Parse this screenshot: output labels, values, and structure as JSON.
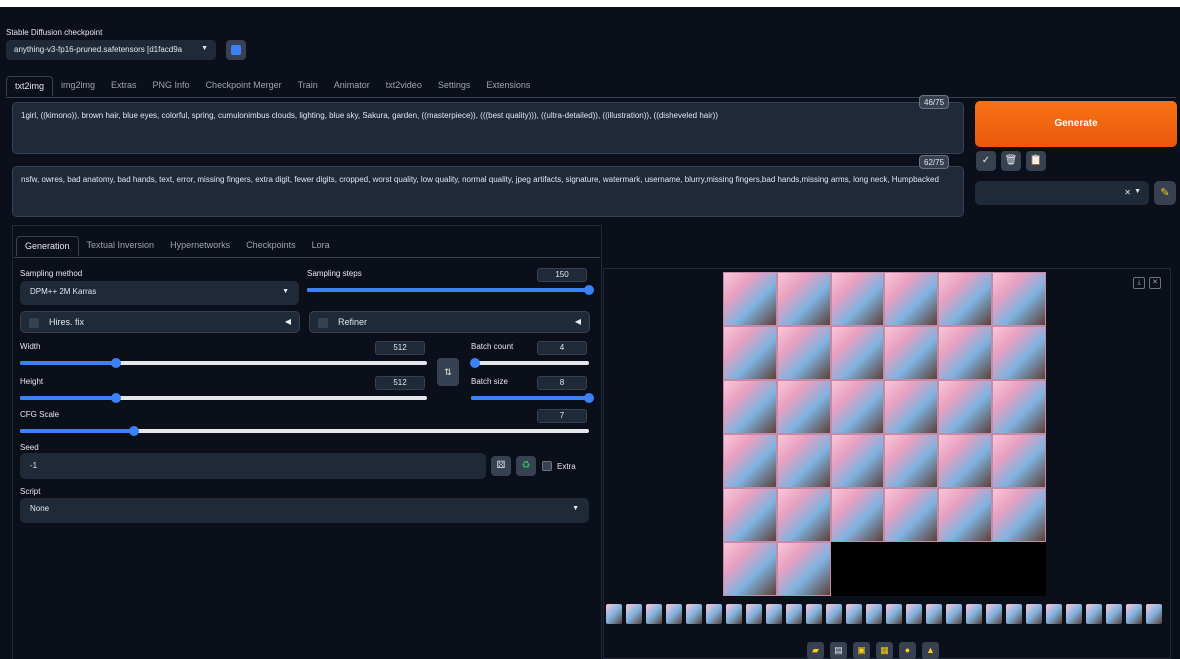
{
  "checkpoint": {
    "label": "Stable Diffusion checkpoint",
    "value": "anything-v3-fp16-pruned.safetensors [d1facd9a",
    "refresh_icon": "refresh-icon"
  },
  "tabs": [
    "txt2img",
    "img2img",
    "Extras",
    "PNG Info",
    "Checkpoint Merger",
    "Train",
    "Animator",
    "txt2video",
    "Settings",
    "Extensions"
  ],
  "active_tab": "txt2img",
  "prompt": {
    "value": "1girl, ((kimono)), brown hair, blue eyes, colorful, spring, cumulonimbus clouds, lighting, blue sky, Sakura, garden, ((masterpiece)), (((best quality))), ((ultra-detailed)), ((illustration)), ((disheveled hair))",
    "counter": "46/75"
  },
  "negative_prompt": {
    "value": "nsfw, owres, bad anatomy, bad hands, text, error, missing fingers, extra digit, fewer digits, cropped, worst quality, low quality, normal quality, jpeg artifacts, signature, watermark, username, blurry,missing fingers,bad hands,missing arms, long neck, Humpbacked",
    "counter": "62/75"
  },
  "generate_label": "Generate",
  "action_icons": {
    "apply": "✓",
    "trash": "🗑",
    "clipboard": "📋",
    "clear": "✕",
    "edit": "✎"
  },
  "subtabs": [
    "Generation",
    "Textual Inversion",
    "Hypernetworks",
    "Checkpoints",
    "Lora"
  ],
  "generation": {
    "sampling_method_label": "Sampling method",
    "sampling_method": "DPM++ 2M Karras",
    "sampling_steps_label": "Sampling steps",
    "sampling_steps": "150",
    "sampling_steps_fraction": 1.0,
    "hires_fix_label": "Hires. fix",
    "refiner_label": "Refiner",
    "width_label": "Width",
    "width": "512",
    "width_fraction": 0.235,
    "height_label": "Height",
    "height": "512",
    "height_fraction": 0.235,
    "swap_icon": "⇅",
    "batch_count_label": "Batch count",
    "batch_count": "4",
    "batch_count_fraction": 0.03,
    "batch_size_label": "Batch size",
    "batch_size": "8",
    "batch_size_fraction": 1.0,
    "cfg_label": "CFG Scale",
    "cfg": "7",
    "cfg_fraction": 0.2,
    "seed_label": "Seed",
    "seed": "-1",
    "extra_label": "Extra",
    "script_label": "Script",
    "script": "None"
  },
  "gallery": {
    "grid_columns": 6,
    "image_count": 32,
    "thumbnail_count": 28,
    "buttons": [
      "folder-icon",
      "save-icon",
      "zip-icon",
      "send-img2img-icon",
      "send-inpaint-icon",
      "send-extras-icon"
    ]
  },
  "colors": {
    "accent_orange": "#f97316",
    "slider_blue": "#3b82f6",
    "background": "#0b0f19"
  }
}
